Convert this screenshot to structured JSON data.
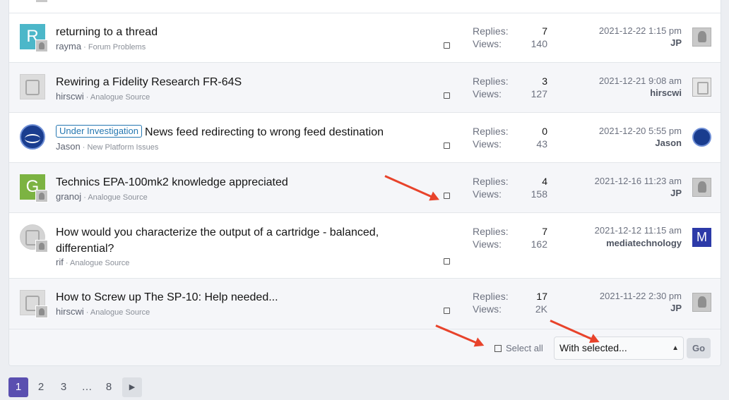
{
  "threads": [
    {
      "title": "returning to a thread",
      "prefix": "",
      "author": "rayma",
      "forum": "Forum Problems",
      "replies_label": "Replies:",
      "replies": "7",
      "views_label": "Views:",
      "views": "140",
      "last_date": "2021-12-22 1:15 pm",
      "last_user": "JP",
      "avatar_letter": "R",
      "avatar_color": "#4cb7c9"
    },
    {
      "title": "Rewiring a Fidelity Research FR-64S",
      "prefix": "",
      "author": "hirscwi",
      "forum": "Analogue Source",
      "replies_label": "Replies:",
      "replies": "3",
      "views_label": "Views:",
      "views": "127",
      "last_date": "2021-12-21 9:08 am",
      "last_user": "hirscwi"
    },
    {
      "title": "News feed redirecting to wrong feed destination",
      "prefix": "Under Investigation",
      "author": "Jason",
      "forum": "New Platform Issues",
      "replies_label": "Replies:",
      "replies": "0",
      "views_label": "Views:",
      "views": "43",
      "last_date": "2021-12-20 5:55 pm",
      "last_user": "Jason"
    },
    {
      "title": "Technics EPA-100mk2 knowledge appreciated",
      "prefix": "",
      "author": "granoj",
      "forum": "Analogue Source",
      "replies_label": "Replies:",
      "replies": "4",
      "views_label": "Views:",
      "views": "158",
      "last_date": "2021-12-16 11:23 am",
      "last_user": "JP",
      "avatar_letter": "G",
      "avatar_color": "#7cb342"
    },
    {
      "title": "How would you characterize the output of a cartridge - balanced, differential?",
      "prefix": "",
      "author": "rif",
      "forum": "Analogue Source",
      "replies_label": "Replies:",
      "replies": "7",
      "views_label": "Views:",
      "views": "162",
      "last_date": "2021-12-12 11:15 am",
      "last_user": "mediatechnology",
      "last_avatar_letter": "M"
    },
    {
      "title": "How to Screw up The SP-10: Help needed...",
      "prefix": "",
      "author": "hirscwi",
      "forum": "Analogue Source",
      "replies_label": "Replies:",
      "replies": "17",
      "views_label": "Views:",
      "views": "2K",
      "last_date": "2021-11-22 2:30 pm",
      "last_user": "JP"
    }
  ],
  "footer": {
    "select_all": "Select all",
    "with_selected": "With selected...",
    "go": "Go"
  },
  "pagination": {
    "pages": [
      "1",
      "2",
      "3",
      "…",
      "8"
    ],
    "current": "1",
    "next_icon": "chevron-right-icon"
  },
  "colors": {
    "accent": "#5a4fb0",
    "prefix_label": "#2577b1",
    "annotation_arrow": "#e8432b"
  }
}
